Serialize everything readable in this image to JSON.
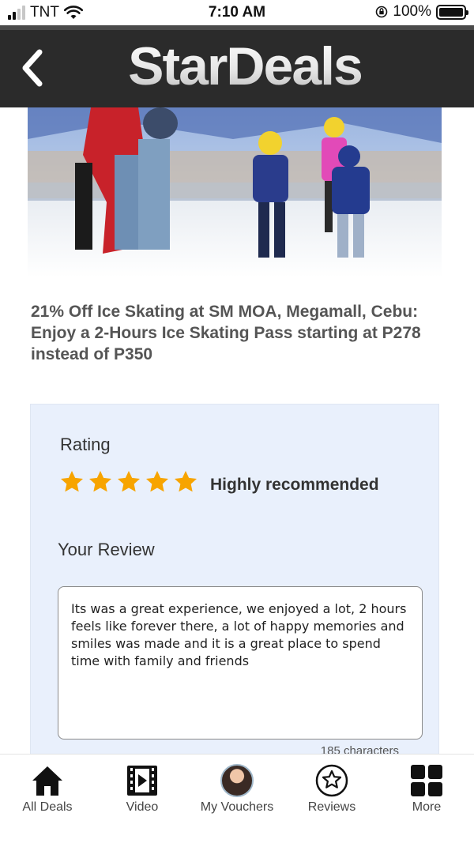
{
  "status_bar": {
    "carrier": "TNT",
    "time": "7:10 AM",
    "battery": "100%"
  },
  "header": {
    "brand": "StarDeals",
    "back_icon": "chevron-left-icon"
  },
  "deal": {
    "title": "21% Off Ice Skating at SM MOA, Megamall, Cebu: Enjoy a 2-Hours Ice Skating Pass starting at P278 instead of P350",
    "image": "ice-skating-photo"
  },
  "review": {
    "rating_label": "Rating",
    "rating_value": 5,
    "rating_max": 5,
    "rating_text": "Highly recommended",
    "review_label": "Your Review",
    "review_text": "Its was a great experience, we enjoyed a lot, 2 hours feels like forever there, a lot of happy memories and smiles was made and it is a great place to spend time with family and friends",
    "char_count": "185 characters"
  },
  "nav": {
    "items": [
      {
        "label": "All Deals",
        "icon": "home-icon"
      },
      {
        "label": "Video",
        "icon": "video-icon"
      },
      {
        "label": "My Vouchers",
        "icon": "avatar-icon"
      },
      {
        "label": "Reviews",
        "icon": "star-circle-icon"
      },
      {
        "label": "More",
        "icon": "grid-icon"
      }
    ]
  },
  "colors": {
    "header_bg": "#2b2b2b",
    "card_bg": "#e9f0fc",
    "star": "#f7a400"
  }
}
